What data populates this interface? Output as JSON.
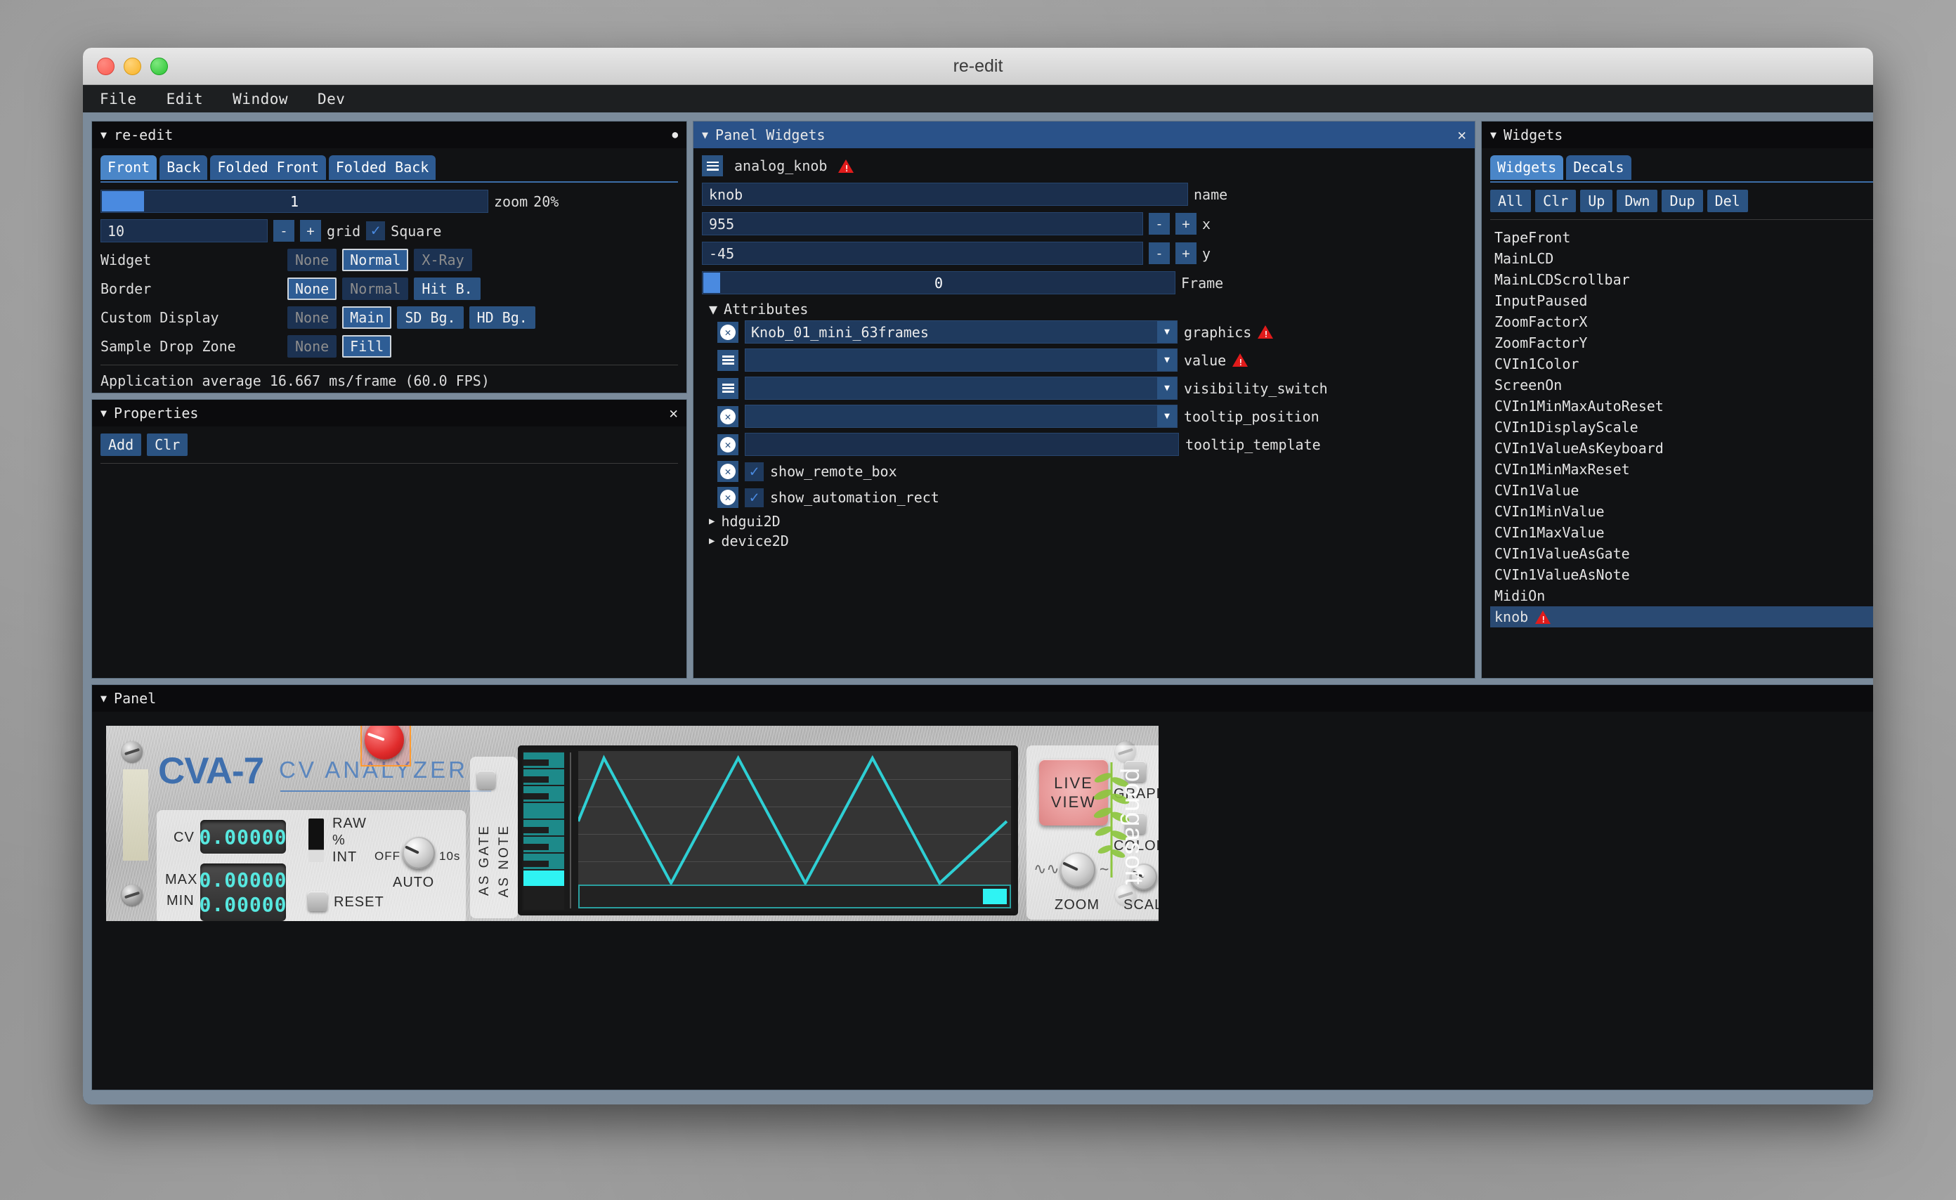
{
  "window": {
    "title": "re-edit"
  },
  "menubar": {
    "items": [
      "File",
      "Edit",
      "Window",
      "Dev"
    ]
  },
  "reedit_panel": {
    "title": "re-edit",
    "dirty_dot": "●",
    "caret": "▼",
    "tabs": [
      "Front",
      "Back",
      "Folded Front",
      "Folded Back"
    ],
    "selected_tab": "Front",
    "zoom_slider_value": "1",
    "zoom_label": "zoom",
    "zoom_value": "20%",
    "grid_value": "10",
    "minus": "-",
    "plus": "+",
    "grid_label": "grid",
    "square_label": "Square",
    "square_checked": "✓",
    "rows": [
      {
        "label": "Widget",
        "options": [
          "None",
          "Normal",
          "X-Ray"
        ],
        "selected": "Normal",
        "disabled": [
          "None",
          "X-Ray"
        ]
      },
      {
        "label": "Border",
        "options": [
          "None",
          "Normal",
          "Hit B."
        ],
        "selected": "None",
        "disabled": [
          "Normal",
          "Hit B."
        ]
      },
      {
        "label": "Custom Display",
        "options": [
          "None",
          "Main",
          "SD Bg.",
          "HD Bg."
        ],
        "selected": "Main",
        "disabled": [
          "None"
        ]
      },
      {
        "label": "Sample Drop Zone",
        "options": [
          "None",
          "Fill"
        ],
        "selected": "Fill",
        "disabled": [
          "None"
        ]
      }
    ],
    "status": "Application average 16.667 ms/frame (60.0 FPS)"
  },
  "properties_panel": {
    "title": "Properties",
    "caret": "▼",
    "close": "✕",
    "buttons": [
      "Add",
      "Clr"
    ]
  },
  "panel_widgets": {
    "title": "Panel Widgets",
    "caret": "▼",
    "close": "✕",
    "widget_type": "analog_knob",
    "widget_has_error": true,
    "name_value": "knob",
    "name_label": "name",
    "x_value": "955",
    "x_label": "x",
    "y_value": "-45",
    "y_label": "y",
    "frame_value": "0",
    "frame_label": "Frame",
    "minus": "-",
    "plus": "+",
    "attributes_label": "Attributes",
    "attributes": [
      {
        "icon": "x-circle-icon",
        "value": "Knob_01_mini_63frames",
        "label": "graphics",
        "combo": true,
        "error": true
      },
      {
        "icon": "hamburger-icon",
        "value": "",
        "label": "value",
        "combo": true,
        "error": true
      },
      {
        "icon": "hamburger-icon",
        "value": "",
        "label": "visibility_switch",
        "combo": true,
        "error": false
      },
      {
        "icon": "x-circle-icon",
        "value": "",
        "label": "tooltip_position",
        "combo": true,
        "error": false
      },
      {
        "icon": "x-circle-icon",
        "value": "",
        "label": "tooltip_template",
        "combo": false,
        "error": false
      }
    ],
    "checkboxes": [
      {
        "icon": "x-circle-icon",
        "label": "show_remote_box",
        "checked": true
      },
      {
        "icon": "x-circle-icon",
        "label": "show_automation_rect",
        "checked": true
      }
    ],
    "trees": [
      "hdgui2D",
      "device2D"
    ],
    "tree_caret": "▶"
  },
  "widgets_panel": {
    "title": "Widgets",
    "caret": "▼",
    "close": "✕",
    "tabs": [
      "Widgets",
      "Decals"
    ],
    "selected_tab": "Widgets",
    "buttons": [
      "All",
      "Clr",
      "Up",
      "Dwn",
      "Dup",
      "Del"
    ],
    "items": [
      {
        "label": "TapeFront",
        "selected": false,
        "error": false
      },
      {
        "label": "MainLCD",
        "selected": false,
        "error": false
      },
      {
        "label": "MainLCDScrollbar",
        "selected": false,
        "error": false
      },
      {
        "label": "InputPaused",
        "selected": false,
        "error": false
      },
      {
        "label": "ZoomFactorX",
        "selected": false,
        "error": false
      },
      {
        "label": "ZoomFactorY",
        "selected": false,
        "error": false
      },
      {
        "label": "CVIn1Color",
        "selected": false,
        "error": false
      },
      {
        "label": "ScreenOn",
        "selected": false,
        "error": false
      },
      {
        "label": "CVIn1MinMaxAutoReset",
        "selected": false,
        "error": false
      },
      {
        "label": "CVIn1DisplayScale",
        "selected": false,
        "error": false
      },
      {
        "label": "CVIn1ValueAsKeyboard",
        "selected": false,
        "error": false
      },
      {
        "label": "CVIn1MinMaxReset",
        "selected": false,
        "error": false
      },
      {
        "label": "CVIn1Value",
        "selected": false,
        "error": false
      },
      {
        "label": "CVIn1MinValue",
        "selected": false,
        "error": false
      },
      {
        "label": "CVIn1MaxValue",
        "selected": false,
        "error": false
      },
      {
        "label": "CVIn1ValueAsGate",
        "selected": false,
        "error": false
      },
      {
        "label": "CVIn1ValueAsNote",
        "selected": false,
        "error": false
      },
      {
        "label": "MidiOn",
        "selected": false,
        "error": false
      },
      {
        "label": "knob",
        "selected": true,
        "error": true
      }
    ]
  },
  "panel": {
    "title": "Panel",
    "caret": "▼",
    "close": "✕",
    "device": {
      "brand": "CVA-7",
      "subtitle": "CV ANALYZER",
      "vendor": "pongasoft",
      "readouts": [
        {
          "label": "CV",
          "value": "0.00000"
        },
        {
          "label": "MAX",
          "value": "0.00000"
        },
        {
          "label": "MIN",
          "value": "0.00000"
        }
      ],
      "mode_labels": [
        "RAW",
        "%",
        "INT"
      ],
      "reset_label": "RESET",
      "auto_label": "AUTO",
      "auto_min": "OFF",
      "auto_max": "10s",
      "gate_labels": [
        "AS GATE",
        "AS NOTE"
      ],
      "live_view_line1": "LIVE",
      "live_view_line2": "VIEW",
      "graph_label": "GRAPH",
      "color_label": "COLOR",
      "zoom_label": "ZOOM",
      "scale_label": "SCALE"
    }
  },
  "colors": {
    "accent_blue": "#2a5289",
    "button_blue": "#2b5382",
    "slider_blue": "#4a8ae0",
    "error_red": "#e11b1b",
    "lcd_cyan": "#57e8e0",
    "panel_bg": "#111214",
    "selection": "#2a4a73"
  }
}
